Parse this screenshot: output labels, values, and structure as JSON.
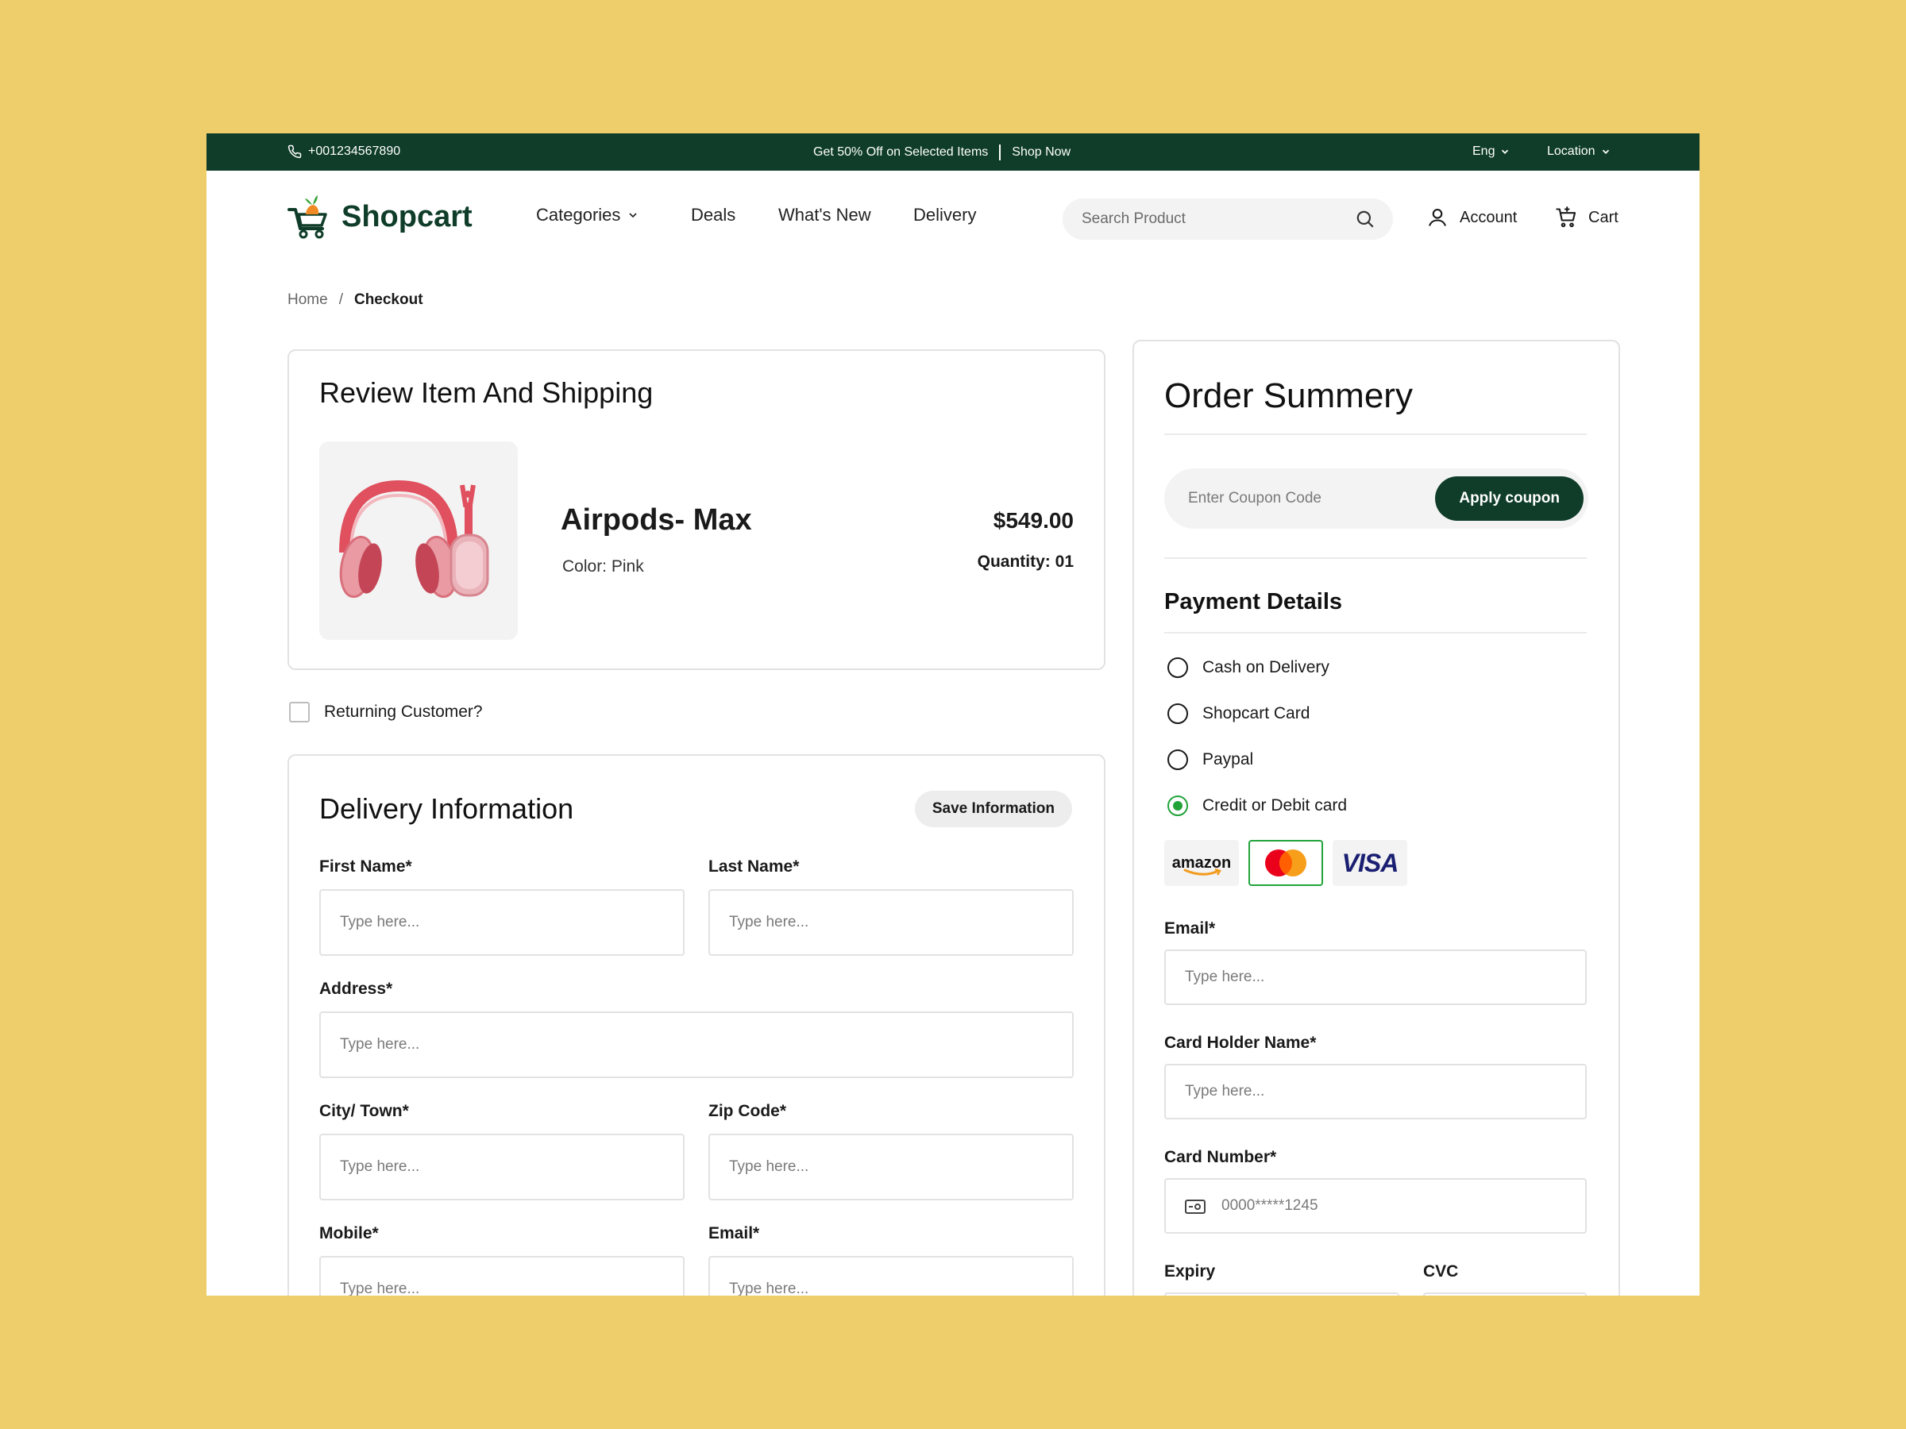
{
  "topbar": {
    "phone": "+001234567890",
    "promo": "Get 50% Off on Selected Items",
    "shop_now": "Shop Now",
    "language": "Eng",
    "location": "Location"
  },
  "header": {
    "logo": "Shopcart",
    "nav": [
      "Categories",
      "Deals",
      "What's New",
      "Delivery"
    ],
    "search_placeholder": "Search Product",
    "account": "Account",
    "cart": "Cart"
  },
  "breadcrumb": {
    "home": "Home",
    "separator": "/",
    "current": "Checkout"
  },
  "review": {
    "title": "Review Item And Shipping",
    "product": {
      "name": "Airpods- Max",
      "color": "Color: Pink",
      "price": "$549.00",
      "quantity": "Quantity: 01"
    }
  },
  "returning_customer": "Returning Customer?",
  "delivery": {
    "title": "Delivery Information",
    "save_button": "Save Information",
    "fields": {
      "first_name": "First Name*",
      "last_name": "Last Name*",
      "address": "Address*",
      "city": "City/ Town*",
      "zip": "Zip Code*",
      "mobile": "Mobile*",
      "email": "Email*"
    },
    "placeholder": "Type here..."
  },
  "summary": {
    "title": "Order Summery",
    "coupon_placeholder": "Enter Coupon Code",
    "coupon_button": "Apply coupon",
    "payment_title": "Payment Details",
    "options": [
      "Cash on Delivery",
      "Shopcart Card",
      "Paypal",
      "Credit or Debit card"
    ],
    "selected_option": "Credit or Debit card",
    "card_brands": [
      "amazon",
      "mastercard",
      "VISA"
    ],
    "selected_brand": "mastercard",
    "fields": {
      "email": "Email*",
      "card_holder": "Card Holder Name*",
      "card_number": "Card Number*",
      "expiry": "Expiry",
      "cvc": "CVC"
    },
    "placeholder": "Type here...",
    "card_number_placeholder": "0000*****1245"
  },
  "colors": {
    "brand_green": "#0F3D29",
    "accent_green": "#22A33A",
    "background": "#EDCE6A"
  }
}
